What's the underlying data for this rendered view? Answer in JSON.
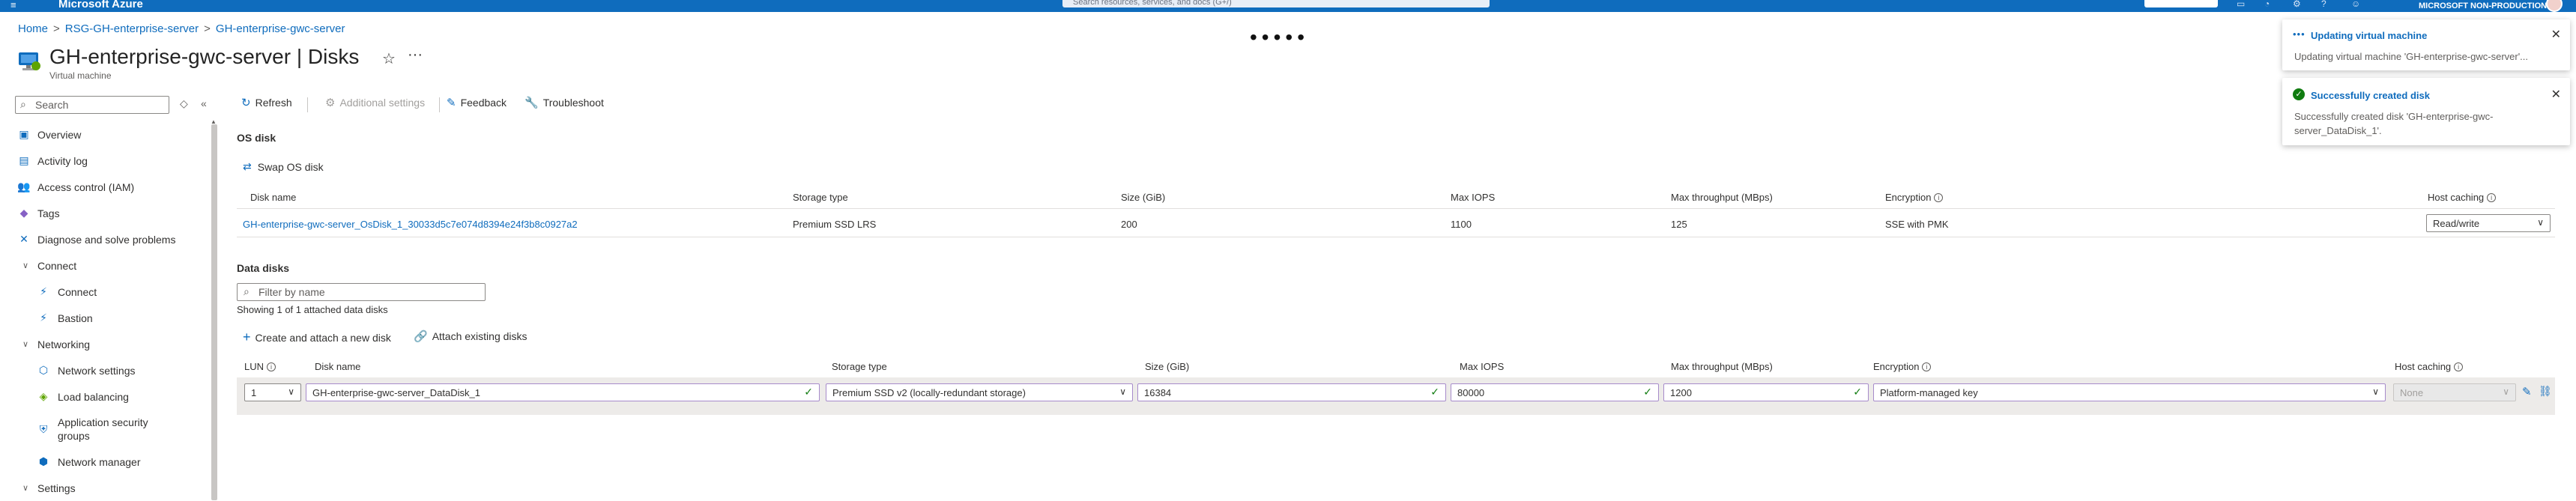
{
  "topbar": {
    "brand": "Microsoft Azure",
    "search_placeholder": "Search resources, services, and docs (G+/)",
    "tenant": "MICROSOFT NON-PRODUCTION"
  },
  "breadcrumb": [
    "Home",
    "RSG-GH-enterprise-server",
    "GH-enterprise-gwc-server"
  ],
  "header": {
    "title": "GH-enterprise-gwc-server | Disks",
    "subtitle": "Virtual machine"
  },
  "sidebar": {
    "search_placeholder": "Search",
    "items": [
      {
        "label": "Overview",
        "icon": "overview-icon",
        "type": "item"
      },
      {
        "label": "Activity log",
        "icon": "activity-log-icon",
        "type": "item"
      },
      {
        "label": "Access control (IAM)",
        "icon": "iam-icon",
        "type": "item"
      },
      {
        "label": "Tags",
        "icon": "tag-icon",
        "type": "item"
      },
      {
        "label": "Diagnose and solve problems",
        "icon": "diagnose-icon",
        "type": "item"
      },
      {
        "label": "Connect",
        "icon": "chevron-down-icon",
        "type": "group"
      },
      {
        "label": "Connect",
        "icon": "connect-icon",
        "type": "sub"
      },
      {
        "label": "Bastion",
        "icon": "bastion-icon",
        "type": "sub"
      },
      {
        "label": "Networking",
        "icon": "chevron-down-icon",
        "type": "group"
      },
      {
        "label": "Network settings",
        "icon": "network-settings-icon",
        "type": "sub"
      },
      {
        "label": "Load balancing",
        "icon": "load-balancing-icon",
        "type": "sub"
      },
      {
        "label": "Application security groups",
        "icon": "asg-icon",
        "type": "sub-two"
      },
      {
        "label": "Network manager",
        "icon": "network-manager-icon",
        "type": "sub"
      },
      {
        "label": "Settings",
        "icon": "chevron-down-icon",
        "type": "group"
      }
    ]
  },
  "toolbar": {
    "refresh": "Refresh",
    "additional_settings": "Additional settings",
    "feedback": "Feedback",
    "troubleshoot": "Troubleshoot"
  },
  "os_disk": {
    "section_title": "OS disk",
    "swap_label": "Swap OS disk",
    "columns": [
      "Disk name",
      "Storage type",
      "Size (GiB)",
      "Max IOPS",
      "Max throughput (MBps)",
      "Encryption",
      "Host caching"
    ],
    "row": {
      "disk_name": "GH-enterprise-gwc-server_OsDisk_1_30033d5c7e074d8394e24f3b8c0927a2",
      "storage_type": "Premium SSD LRS",
      "size": "200",
      "max_iops": "1100",
      "max_throughput": "125",
      "encryption": "SSE with PMK",
      "host_caching": "Read/write"
    }
  },
  "data_disks": {
    "section_title": "Data disks",
    "filter_placeholder": "Filter by name",
    "showing": "Showing 1 of 1 attached data disks",
    "create_label": "Create and attach a new disk",
    "attach_label": "Attach existing disks",
    "columns": [
      "LUN",
      "Disk name",
      "Storage type",
      "Size (GiB)",
      "Max IOPS",
      "Max throughput (MBps)",
      "Encryption",
      "Host caching"
    ],
    "row": {
      "lun": "1",
      "disk_name": "GH-enterprise-gwc-server_DataDisk_1",
      "storage_type": "Premium SSD v2 (locally-redundant storage)",
      "size": "16384",
      "max_iops": "80000",
      "max_throughput": "1200",
      "encryption": "Platform-managed key",
      "host_caching": "None"
    }
  },
  "notifications": [
    {
      "title": "Updating virtual machine",
      "body": "Updating virtual machine 'GH-enterprise-gwc-server'...",
      "status": "in-progress"
    },
    {
      "title": "Successfully created disk",
      "body": "Successfully created disk 'GH-enterprise-gwc-server_DataDisk_1'.",
      "status": "success"
    }
  ],
  "colors": {
    "accent": "#0f6cbd",
    "success": "#107c10",
    "row_bg": "#edebe9"
  }
}
